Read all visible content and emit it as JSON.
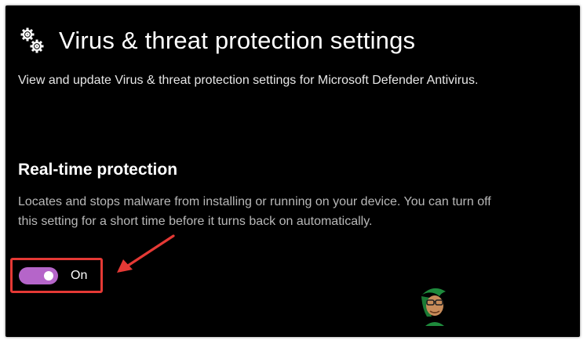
{
  "header": {
    "title": "Virus & threat protection settings",
    "icon": "gears-icon"
  },
  "description": "View and update Virus & threat protection settings for Microsoft Defender Antivirus.",
  "section": {
    "title": "Real-time protection",
    "description": "Locates and stops malware from installing or running on your device. You can turn off this setting for a short time before it turns back on automatically.",
    "toggle": {
      "state": "on",
      "label": "On"
    }
  },
  "annotation": {
    "highlight": "red-rectangle",
    "arrow": "red-arrow"
  },
  "colors": {
    "background": "#000000",
    "toggle_on": "#b565c9",
    "annotation_red": "#e53935",
    "secondary_text": "#b8b8b8"
  }
}
